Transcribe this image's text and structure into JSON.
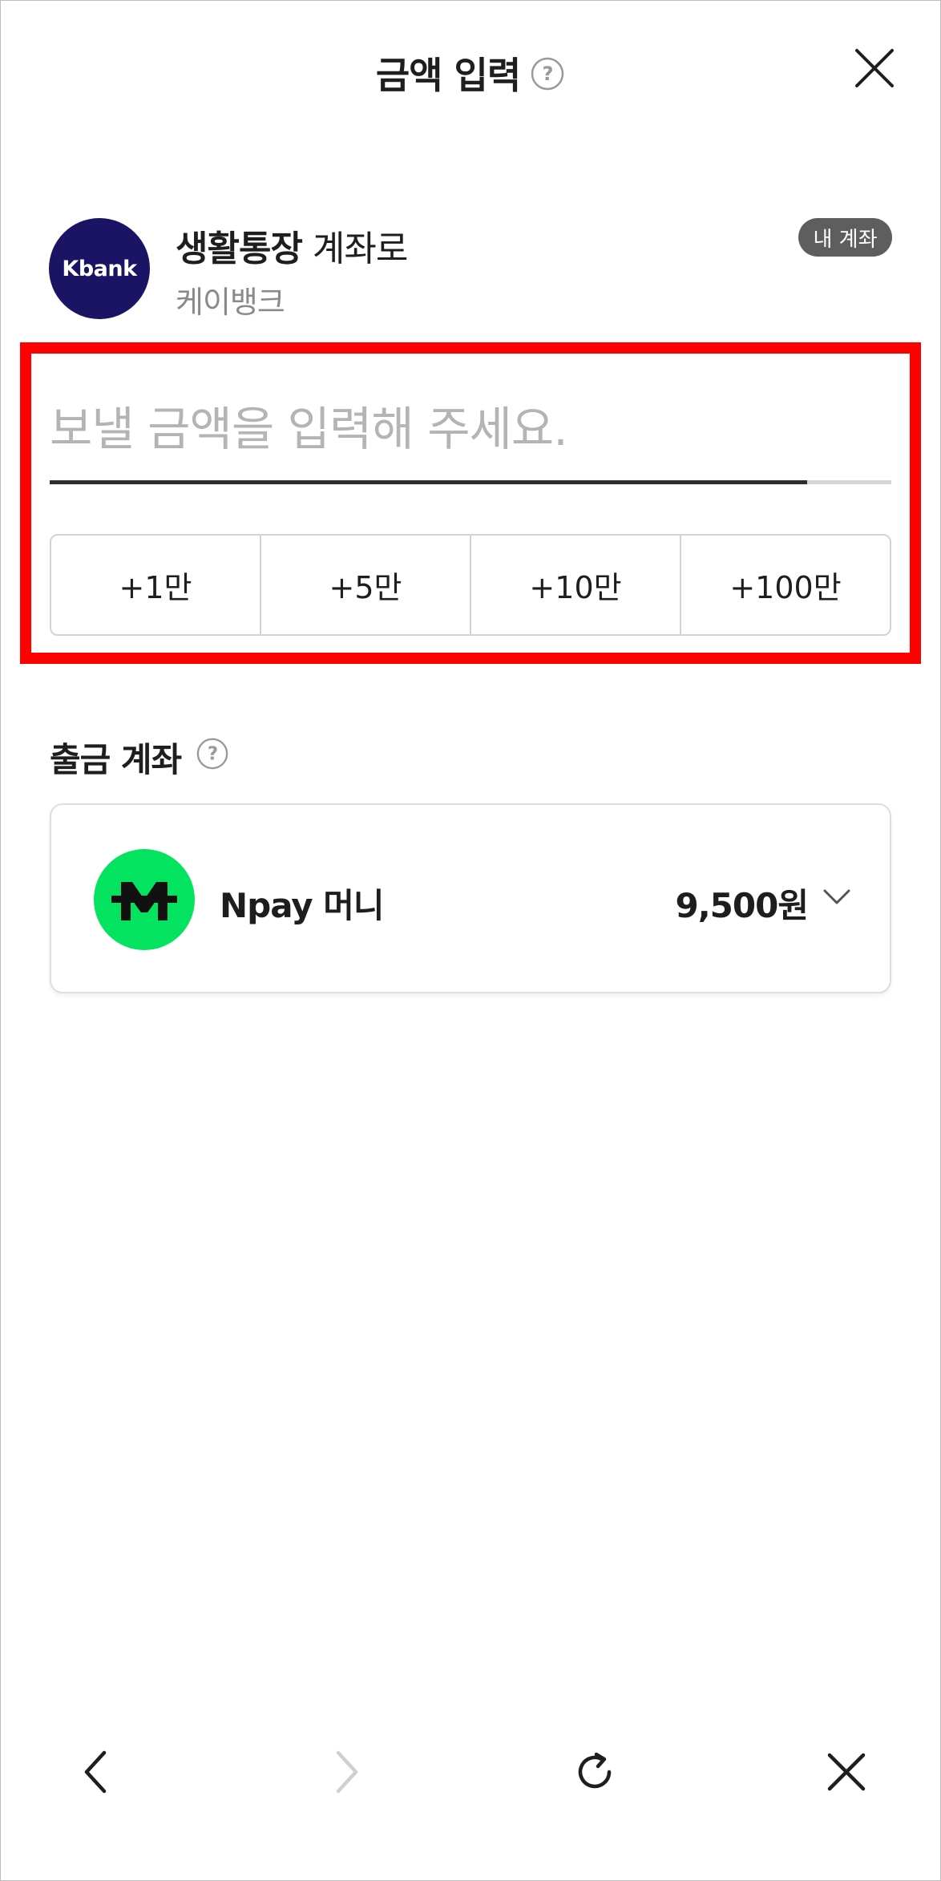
{
  "header": {
    "title": "금액 입력"
  },
  "recipient": {
    "logo_text": "Kbank",
    "account_name": "생활통장",
    "account_suffix": " 계좌로",
    "bank": "케이뱅크",
    "badge": "내 계좌"
  },
  "amount": {
    "value": "",
    "placeholder": "보낼 금액을 입력해 주세요."
  },
  "quick_add": {
    "buttons": [
      "+1만",
      "+5만",
      "+10만",
      "+100만"
    ]
  },
  "source": {
    "label": "출금 계좌",
    "account_name": "Npay 머니",
    "balance": "9,500원"
  },
  "icons": {
    "help": "help-circle-icon",
    "close": "close-icon",
    "chevron": "chevron-down-icon",
    "nav_back": "back-arrow-icon",
    "nav_forward": "forward-arrow-icon",
    "nav_refresh": "refresh-icon",
    "nav_close": "close-icon"
  },
  "colors": {
    "kbank": "#1b1464",
    "npay": "#03e35f",
    "highlight": "#ff0000",
    "badge": "#5e5e5e"
  }
}
